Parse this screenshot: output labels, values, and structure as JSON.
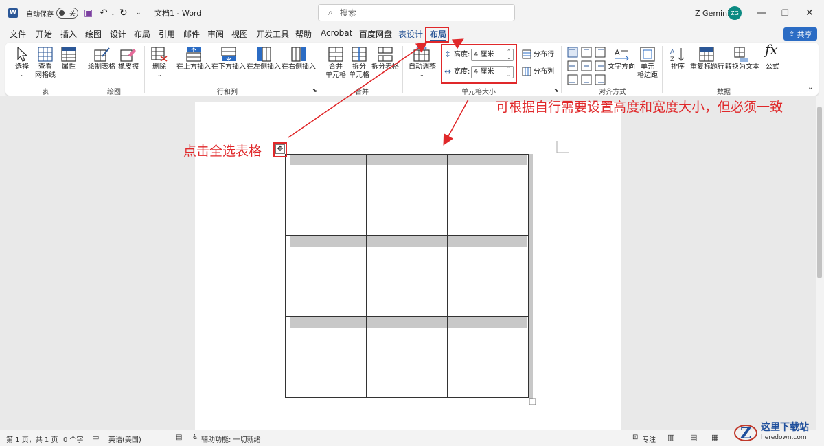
{
  "titlebar": {
    "autosave_label": "自动保存",
    "autosave_state": "关",
    "doc_title": "文档1 - Word",
    "search_placeholder": "搜索",
    "user_name": "Z Gemini",
    "user_initials": "ZG"
  },
  "menu": {
    "items": [
      "文件",
      "开始",
      "插入",
      "绘图",
      "设计",
      "布局",
      "引用",
      "邮件",
      "审阅",
      "视图",
      "开发工具",
      "帮助",
      "Acrobat",
      "百度网盘",
      "表设计",
      "布局"
    ],
    "share_label": "共享"
  },
  "ribbon": {
    "table_group": {
      "label": "表",
      "select": "选择",
      "gridlines_1": "查看",
      "gridlines_2": "网格线",
      "properties": "属性"
    },
    "draw_group": {
      "label": "绘图",
      "draw_table": "绘制表格",
      "eraser": "橡皮擦"
    },
    "rows_cols_group": {
      "label": "行和列",
      "delete": "删除",
      "insert_above": "在上方插入",
      "insert_below": "在下方插入",
      "insert_left": "在左侧插入",
      "insert_right": "在右侧插入"
    },
    "merge_group": {
      "label": "合并",
      "merge_1": "合并",
      "merge_2": "单元格",
      "split_1": "拆分",
      "split_2": "单元格",
      "split_table": "拆分表格"
    },
    "cell_size_group": {
      "label": "单元格大小",
      "autofit": "自动调整",
      "height_label": "高度:",
      "height_value": "4 厘米",
      "width_label": "宽度:",
      "width_value": "4 厘米",
      "distribute_rows": "分布行",
      "distribute_cols": "分布列"
    },
    "alignment_group": {
      "label": "对齐方式",
      "text_direction": "文字方向",
      "cell_margins_1": "单元",
      "cell_margins_2": "格边距"
    },
    "data_group": {
      "label": "数据",
      "sort": "排序",
      "repeat_header": "重复标题行",
      "convert_text": "转换为文本",
      "formula": "公式"
    }
  },
  "annotations": {
    "select_all": "点击全选表格",
    "size_note": "可根据自行需要设置高度和宽度大小，但必须一致"
  },
  "statusbar": {
    "page": "第 1 页，共 1 页",
    "words": "0 个字",
    "language": "英语(美国)",
    "accessibility": "辅助功能: 一切就绪",
    "focus": "专注"
  },
  "watermark": {
    "name": "这里下载站",
    "url": "heredown.com"
  },
  "colors": {
    "accent": "#2b5797",
    "annotation": "#e0282a",
    "share": "#2b6cc4"
  }
}
